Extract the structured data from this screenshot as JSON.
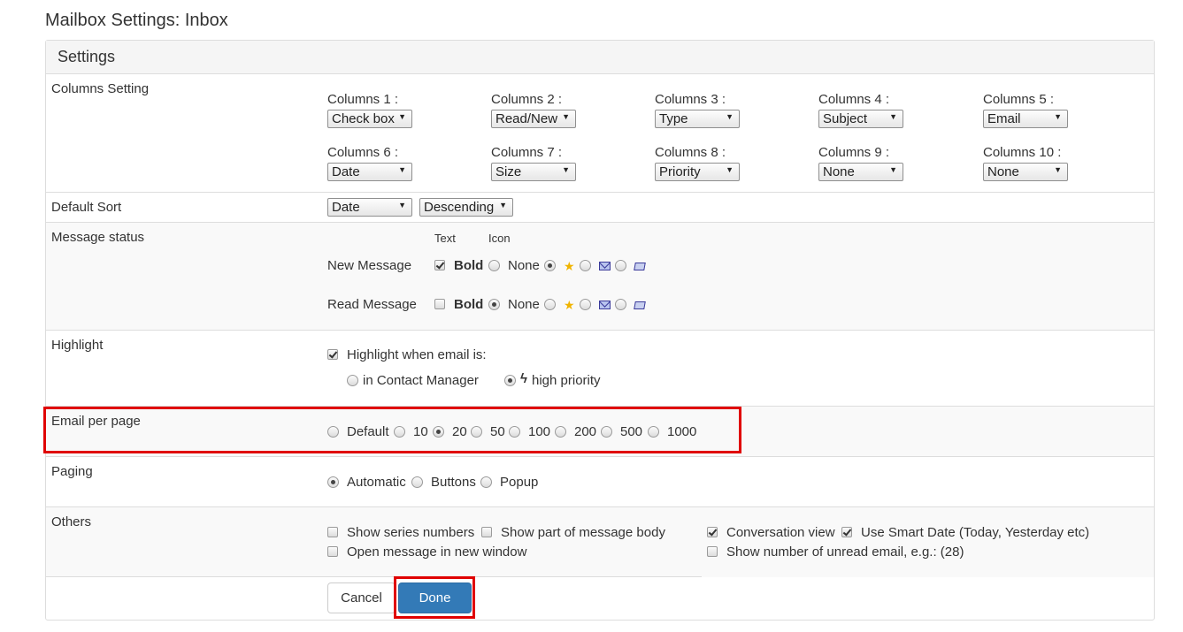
{
  "page_title": "Mailbox Settings: Inbox",
  "panel_title": "Settings",
  "columns_setting": {
    "label": "Columns Setting",
    "columns": [
      {
        "label": "Columns 1 :",
        "value": "Check box"
      },
      {
        "label": "Columns 2 :",
        "value": "Read/New"
      },
      {
        "label": "Columns 3 :",
        "value": "Type"
      },
      {
        "label": "Columns 4 :",
        "value": "Subject"
      },
      {
        "label": "Columns 5 :",
        "value": "Email"
      },
      {
        "label": "Columns 6 :",
        "value": "Date"
      },
      {
        "label": "Columns 7 :",
        "value": "Size"
      },
      {
        "label": "Columns 8 :",
        "value": "Priority"
      },
      {
        "label": "Columns 9 :",
        "value": "None"
      },
      {
        "label": "Columns 10 :",
        "value": "None"
      }
    ]
  },
  "default_sort": {
    "label": "Default Sort",
    "field": "Date",
    "order": "Descending"
  },
  "message_status": {
    "label": "Message status",
    "header_text": "Text",
    "header_icon": "Icon",
    "new_message": {
      "label": "New Message",
      "bold_label": "Bold",
      "none_label": "None"
    },
    "read_message": {
      "label": "Read Message",
      "bold_label": "Bold",
      "none_label": "None"
    }
  },
  "highlight": {
    "label": "Highlight",
    "checkbox_label": "Highlight when email is:",
    "option_contact": "in Contact Manager",
    "option_priority": "high priority"
  },
  "email_per_page": {
    "label": "Email per page",
    "options": [
      "Default",
      "10",
      "20",
      "50",
      "100",
      "200",
      "500",
      "1000"
    ],
    "selected": "20"
  },
  "paging": {
    "label": "Paging",
    "options": [
      "Automatic",
      "Buttons",
      "Popup"
    ],
    "selected": "Automatic"
  },
  "others": {
    "label": "Others",
    "show_series_numbers": "Show series numbers",
    "show_part_body": "Show part of message body",
    "open_new_window": "Open message in new window",
    "conversation_view": "Conversation view",
    "smart_date": "Use Smart Date (Today, Yesterday etc)",
    "show_unread_count": "Show number of unread email, e.g.: (28)"
  },
  "buttons": {
    "cancel": "Cancel",
    "done": "Done"
  },
  "colors": {
    "primary": "#337ab7",
    "highlight_border": "#e00000"
  }
}
